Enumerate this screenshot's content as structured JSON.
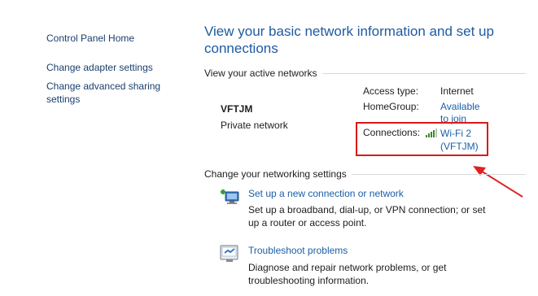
{
  "sidebar": {
    "items": [
      {
        "label": "Control Panel Home"
      },
      {
        "label": "Change adapter settings"
      },
      {
        "label": "Change advanced sharing settings"
      }
    ]
  },
  "main": {
    "title": "View your basic network information and set up connections",
    "active_networks_header": "View your active networks",
    "network": {
      "name": "VFTJM",
      "type": "Private network",
      "access_type_label": "Access type:",
      "access_type_value": "Internet",
      "homegroup_label": "HomeGroup:",
      "homegroup_value": "Available to join",
      "connections_label": "Connections:",
      "connections_value": "Wi-Fi 2 (VFTJM)"
    },
    "settings_header": "Change your networking settings",
    "tasks": [
      {
        "icon": "new-connection-icon",
        "link": "Set up a new connection or network",
        "description": "Set up a broadband, dial-up, or VPN connection; or set up a router or access point."
      },
      {
        "icon": "troubleshoot-icon",
        "link": "Troubleshoot problems",
        "description": "Diagnose and repair network problems, or get troubleshooting information."
      }
    ]
  },
  "colors": {
    "highlight_box": "#d91a1a",
    "link": "#1a5ea8",
    "title": "#1e5aa0"
  }
}
